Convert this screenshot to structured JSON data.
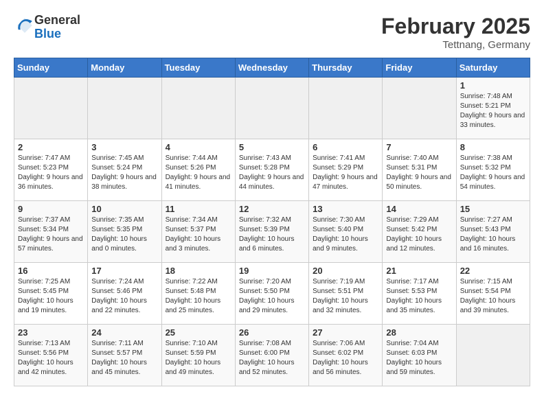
{
  "header": {
    "logo_general": "General",
    "logo_blue": "Blue",
    "month_title": "February 2025",
    "location": "Tettnang, Germany"
  },
  "days_of_week": [
    "Sunday",
    "Monday",
    "Tuesday",
    "Wednesday",
    "Thursday",
    "Friday",
    "Saturday"
  ],
  "weeks": [
    [
      {
        "day": "",
        "info": ""
      },
      {
        "day": "",
        "info": ""
      },
      {
        "day": "",
        "info": ""
      },
      {
        "day": "",
        "info": ""
      },
      {
        "day": "",
        "info": ""
      },
      {
        "day": "",
        "info": ""
      },
      {
        "day": "1",
        "info": "Sunrise: 7:48 AM\nSunset: 5:21 PM\nDaylight: 9 hours and 33 minutes."
      }
    ],
    [
      {
        "day": "2",
        "info": "Sunrise: 7:47 AM\nSunset: 5:23 PM\nDaylight: 9 hours and 36 minutes."
      },
      {
        "day": "3",
        "info": "Sunrise: 7:45 AM\nSunset: 5:24 PM\nDaylight: 9 hours and 38 minutes."
      },
      {
        "day": "4",
        "info": "Sunrise: 7:44 AM\nSunset: 5:26 PM\nDaylight: 9 hours and 41 minutes."
      },
      {
        "day": "5",
        "info": "Sunrise: 7:43 AM\nSunset: 5:28 PM\nDaylight: 9 hours and 44 minutes."
      },
      {
        "day": "6",
        "info": "Sunrise: 7:41 AM\nSunset: 5:29 PM\nDaylight: 9 hours and 47 minutes."
      },
      {
        "day": "7",
        "info": "Sunrise: 7:40 AM\nSunset: 5:31 PM\nDaylight: 9 hours and 50 minutes."
      },
      {
        "day": "8",
        "info": "Sunrise: 7:38 AM\nSunset: 5:32 PM\nDaylight: 9 hours and 54 minutes."
      }
    ],
    [
      {
        "day": "9",
        "info": "Sunrise: 7:37 AM\nSunset: 5:34 PM\nDaylight: 9 hours and 57 minutes."
      },
      {
        "day": "10",
        "info": "Sunrise: 7:35 AM\nSunset: 5:35 PM\nDaylight: 10 hours and 0 minutes."
      },
      {
        "day": "11",
        "info": "Sunrise: 7:34 AM\nSunset: 5:37 PM\nDaylight: 10 hours and 3 minutes."
      },
      {
        "day": "12",
        "info": "Sunrise: 7:32 AM\nSunset: 5:39 PM\nDaylight: 10 hours and 6 minutes."
      },
      {
        "day": "13",
        "info": "Sunrise: 7:30 AM\nSunset: 5:40 PM\nDaylight: 10 hours and 9 minutes."
      },
      {
        "day": "14",
        "info": "Sunrise: 7:29 AM\nSunset: 5:42 PM\nDaylight: 10 hours and 12 minutes."
      },
      {
        "day": "15",
        "info": "Sunrise: 7:27 AM\nSunset: 5:43 PM\nDaylight: 10 hours and 16 minutes."
      }
    ],
    [
      {
        "day": "16",
        "info": "Sunrise: 7:25 AM\nSunset: 5:45 PM\nDaylight: 10 hours and 19 minutes."
      },
      {
        "day": "17",
        "info": "Sunrise: 7:24 AM\nSunset: 5:46 PM\nDaylight: 10 hours and 22 minutes."
      },
      {
        "day": "18",
        "info": "Sunrise: 7:22 AM\nSunset: 5:48 PM\nDaylight: 10 hours and 25 minutes."
      },
      {
        "day": "19",
        "info": "Sunrise: 7:20 AM\nSunset: 5:50 PM\nDaylight: 10 hours and 29 minutes."
      },
      {
        "day": "20",
        "info": "Sunrise: 7:19 AM\nSunset: 5:51 PM\nDaylight: 10 hours and 32 minutes."
      },
      {
        "day": "21",
        "info": "Sunrise: 7:17 AM\nSunset: 5:53 PM\nDaylight: 10 hours and 35 minutes."
      },
      {
        "day": "22",
        "info": "Sunrise: 7:15 AM\nSunset: 5:54 PM\nDaylight: 10 hours and 39 minutes."
      }
    ],
    [
      {
        "day": "23",
        "info": "Sunrise: 7:13 AM\nSunset: 5:56 PM\nDaylight: 10 hours and 42 minutes."
      },
      {
        "day": "24",
        "info": "Sunrise: 7:11 AM\nSunset: 5:57 PM\nDaylight: 10 hours and 45 minutes."
      },
      {
        "day": "25",
        "info": "Sunrise: 7:10 AM\nSunset: 5:59 PM\nDaylight: 10 hours and 49 minutes."
      },
      {
        "day": "26",
        "info": "Sunrise: 7:08 AM\nSunset: 6:00 PM\nDaylight: 10 hours and 52 minutes."
      },
      {
        "day": "27",
        "info": "Sunrise: 7:06 AM\nSunset: 6:02 PM\nDaylight: 10 hours and 56 minutes."
      },
      {
        "day": "28",
        "info": "Sunrise: 7:04 AM\nSunset: 6:03 PM\nDaylight: 10 hours and 59 minutes."
      },
      {
        "day": "",
        "info": ""
      }
    ]
  ]
}
